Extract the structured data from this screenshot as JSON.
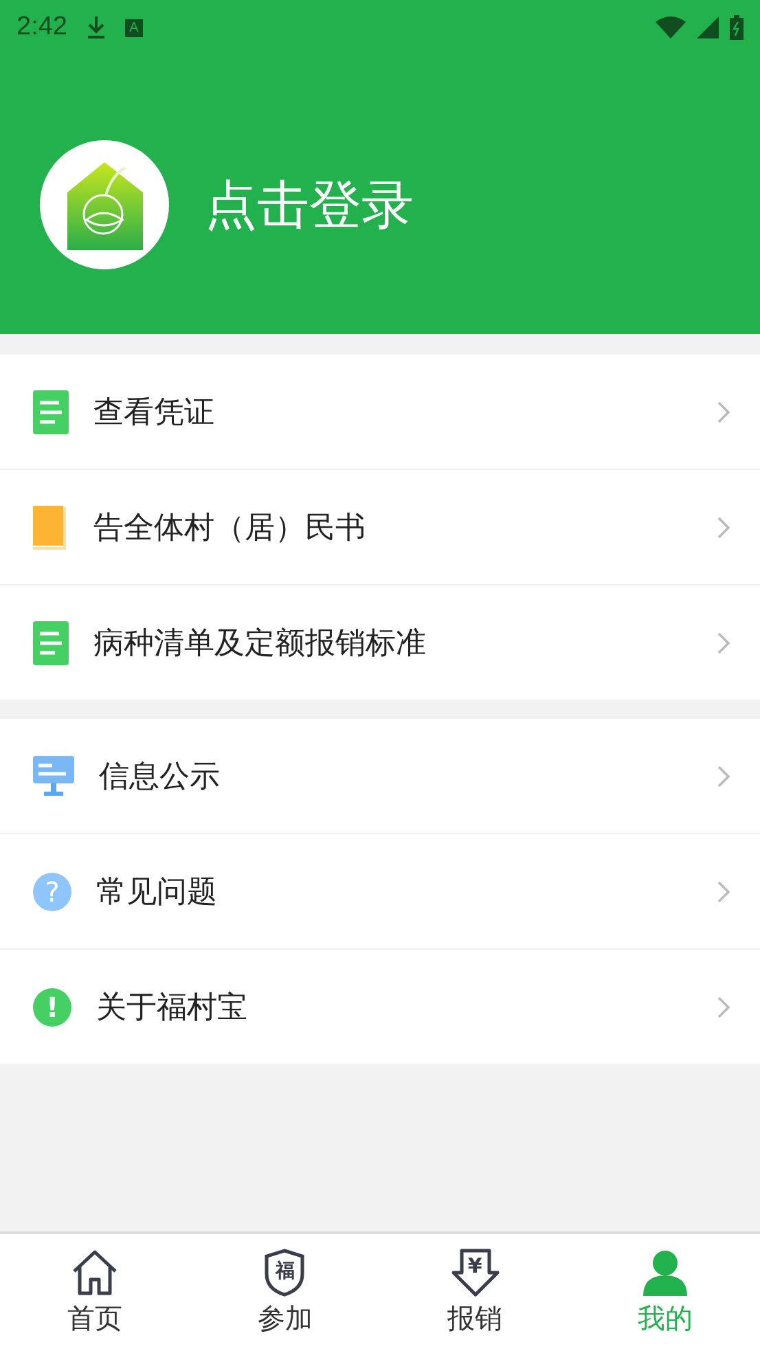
{
  "status_bar": {
    "time": "2:42",
    "notification_glyph": "A"
  },
  "header": {
    "login_text": "点击登录"
  },
  "menu_groups": [
    {
      "items": [
        {
          "label": "查看凭证",
          "kind": "document"
        },
        {
          "label": "告全体村（居）民书",
          "kind": "book"
        },
        {
          "label": "病种清单及定额报销标准",
          "kind": "document"
        }
      ]
    },
    {
      "items": [
        {
          "label": "信息公示",
          "kind": "monitor"
        },
        {
          "label": "常见问题",
          "kind": "question",
          "glyph": "?"
        },
        {
          "label": "关于福村宝",
          "kind": "info",
          "glyph": "!"
        }
      ]
    }
  ],
  "tab_bar": [
    {
      "label": "首页",
      "kind": "home",
      "selected": false
    },
    {
      "label": "参加",
      "kind": "shield",
      "glyph": "福",
      "selected": false
    },
    {
      "label": "报销",
      "kind": "arrow",
      "glyph": "¥",
      "selected": false
    },
    {
      "label": "我的",
      "kind": "person",
      "selected": true
    }
  ]
}
